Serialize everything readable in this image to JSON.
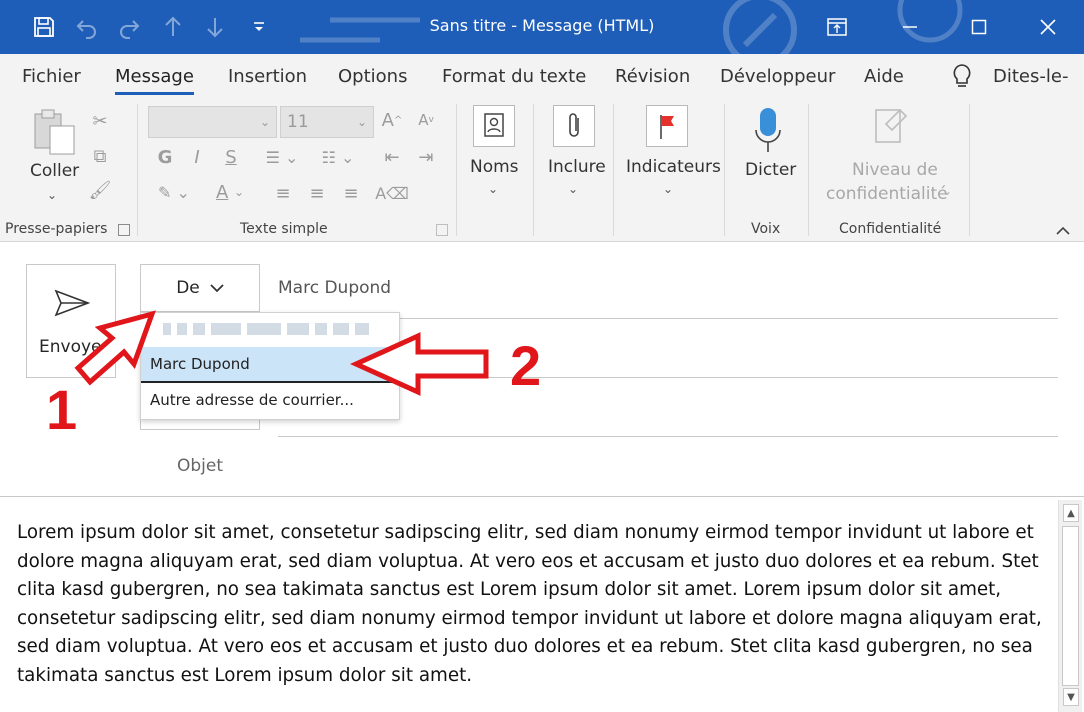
{
  "window": {
    "title": "Sans titre  -  Message (HTML)"
  },
  "tabs": [
    "Fichier",
    "Message",
    "Insertion",
    "Options",
    "Format du texte",
    "Révision",
    "Développeur",
    "Aide",
    "Dites-le-"
  ],
  "active_tab": "Message",
  "ribbon": {
    "paste_label": "Coller",
    "clipboard_group": "Presse-papiers",
    "font_size": "11",
    "basic_text_group": "Texte simple",
    "names_label": "Noms",
    "include_label": "Inclure",
    "flags_label": "Indicateurs",
    "dictate_label": "Dicter",
    "voice_group": "Voix",
    "sensitivity_label_1": "Niveau de",
    "sensitivity_label_2": "confidentialité",
    "sensitivity_group": "Confidentialité",
    "format_buttons": [
      "G",
      "I",
      "S"
    ]
  },
  "compose": {
    "send_label": "Envoyer",
    "from_label": "De",
    "from_value": "Marc Dupond",
    "subject_label": "Objet"
  },
  "dropdown": {
    "items": [
      "Marc Dupond",
      "Autre adresse de courrier..."
    ],
    "selected": "Marc Dupond"
  },
  "annotations": [
    "1",
    "2"
  ],
  "body_text": "Lorem ipsum dolor sit amet, consetetur sadipscing elitr, sed diam nonumy eirmod tempor invidunt ut labore et dolore magna aliquyam erat, sed diam voluptua. At vero eos et accusam et justo duo dolores et ea rebum. Stet clita kasd gubergren, no sea takimata sanctus est Lorem ipsum dolor sit amet. Lorem ipsum dolor sit amet, consetetur sadipscing elitr, sed diam nonumy eirmod tempor invidunt ut labore et dolore magna aliquyam erat, sed diam voluptua. At vero eos et accusam et justo duo dolores et ea rebum. Stet clita kasd gubergren, no sea takimata sanctus est Lorem ipsum dolor sit amet.",
  "colors": {
    "title_bar": "#1e5eb8",
    "annotation_red": "#e0161b",
    "selection": "#cce4f7"
  }
}
